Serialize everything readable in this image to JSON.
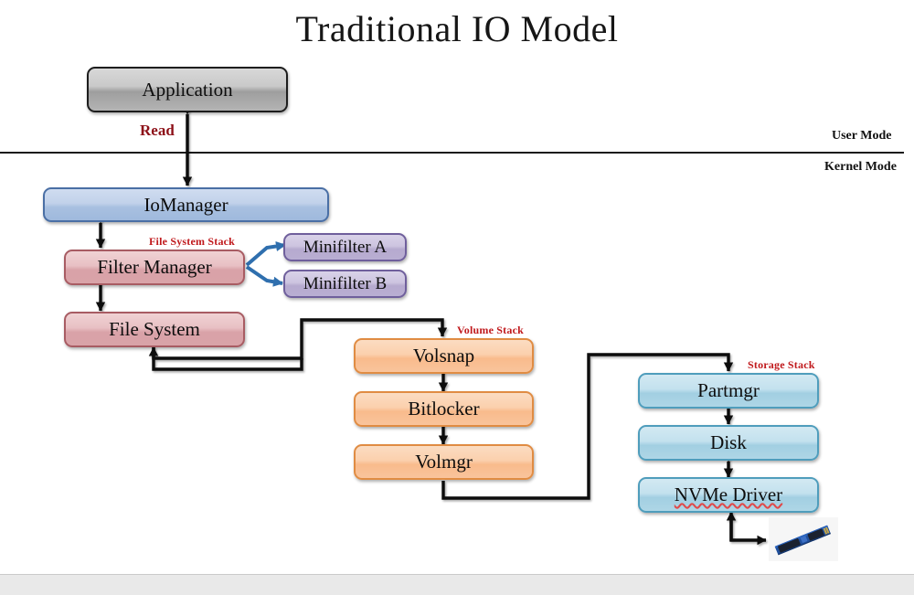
{
  "title": "Traditional IO Model",
  "mode_labels": {
    "user": "User Mode",
    "kernel": "Kernel Mode"
  },
  "edge_labels": {
    "read": "Read"
  },
  "stack_labels": {
    "file_system_stack": "File System Stack",
    "volume_stack": "Volume Stack",
    "storage_stack": "Storage Stack"
  },
  "nodes": {
    "application": "Application",
    "iomanager": "IoManager",
    "filter_manager": "Filter Manager",
    "minifilter_a": "Minifilter A",
    "minifilter_b": "Minifilter B",
    "file_system": "File System",
    "volsnap": "Volsnap",
    "bitlocker": "Bitlocker",
    "volmgr": "Volmgr",
    "partmgr": "Partmgr",
    "disk": "Disk",
    "nvme_driver": "NVMe Driver"
  },
  "device": {
    "name": "nvme-ssd-photo"
  },
  "colors": {
    "title": "#161616",
    "accent_red": "#c0191c",
    "read_red": "#8d1018",
    "gray_node_border": "#1d1d1d",
    "blue_node_border": "#4a6fa5",
    "red_node_border": "#a85c63",
    "purple_node_border": "#6f5f9c",
    "orange_node_border": "#e08c43",
    "cyan_node_border": "#4f9dbc",
    "wire": "#0a0a0a",
    "minifilter_arrow": "#2f6fae",
    "footer": "#e9e9e9"
  }
}
